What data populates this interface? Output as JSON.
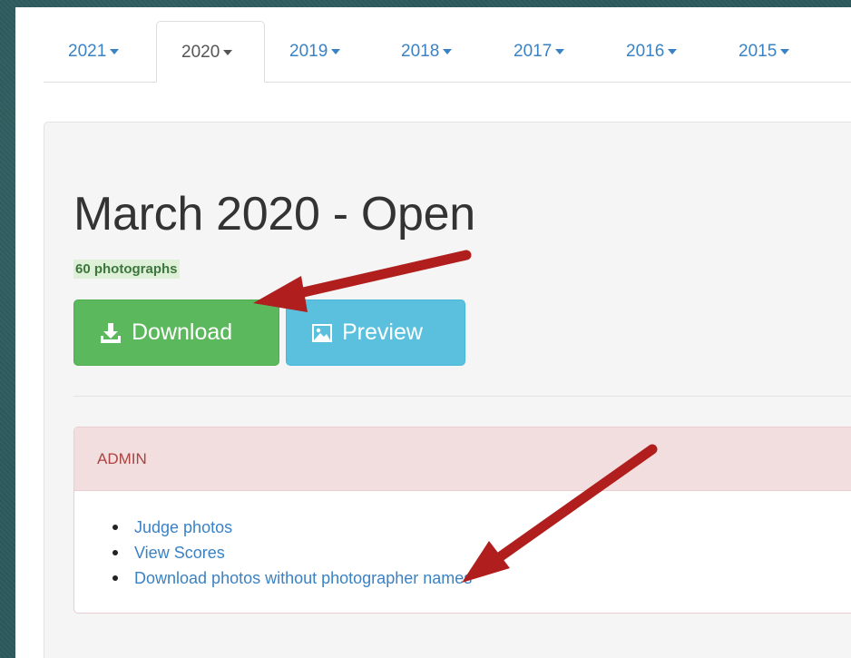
{
  "tabs": [
    {
      "label": "2021",
      "active": false
    },
    {
      "label": "2020",
      "active": true
    },
    {
      "label": "2019",
      "active": false
    },
    {
      "label": "2018",
      "active": false
    },
    {
      "label": "2017",
      "active": false
    },
    {
      "label": "2016",
      "active": false
    },
    {
      "label": "2015",
      "active": false
    }
  ],
  "competition": {
    "title": "March 2020 - Open",
    "photo_count": "60 photographs"
  },
  "buttons": {
    "download": "Download",
    "preview": "Preview"
  },
  "admin": {
    "heading": "ADMIN",
    "links": [
      "Judge photos",
      "View Scores",
      "Download photos without photographer names"
    ]
  },
  "colors": {
    "background": "#2c5a5d",
    "link": "#3a82c4",
    "success": "#5cb85c",
    "info": "#5bc0de",
    "danger_text": "#a94442",
    "danger_bg": "#f2dede",
    "annotation_arrow": "#b01e1e"
  },
  "icons": {
    "download": "download-icon",
    "preview": "picture-icon",
    "tab_caret": "caret-down-icon"
  }
}
